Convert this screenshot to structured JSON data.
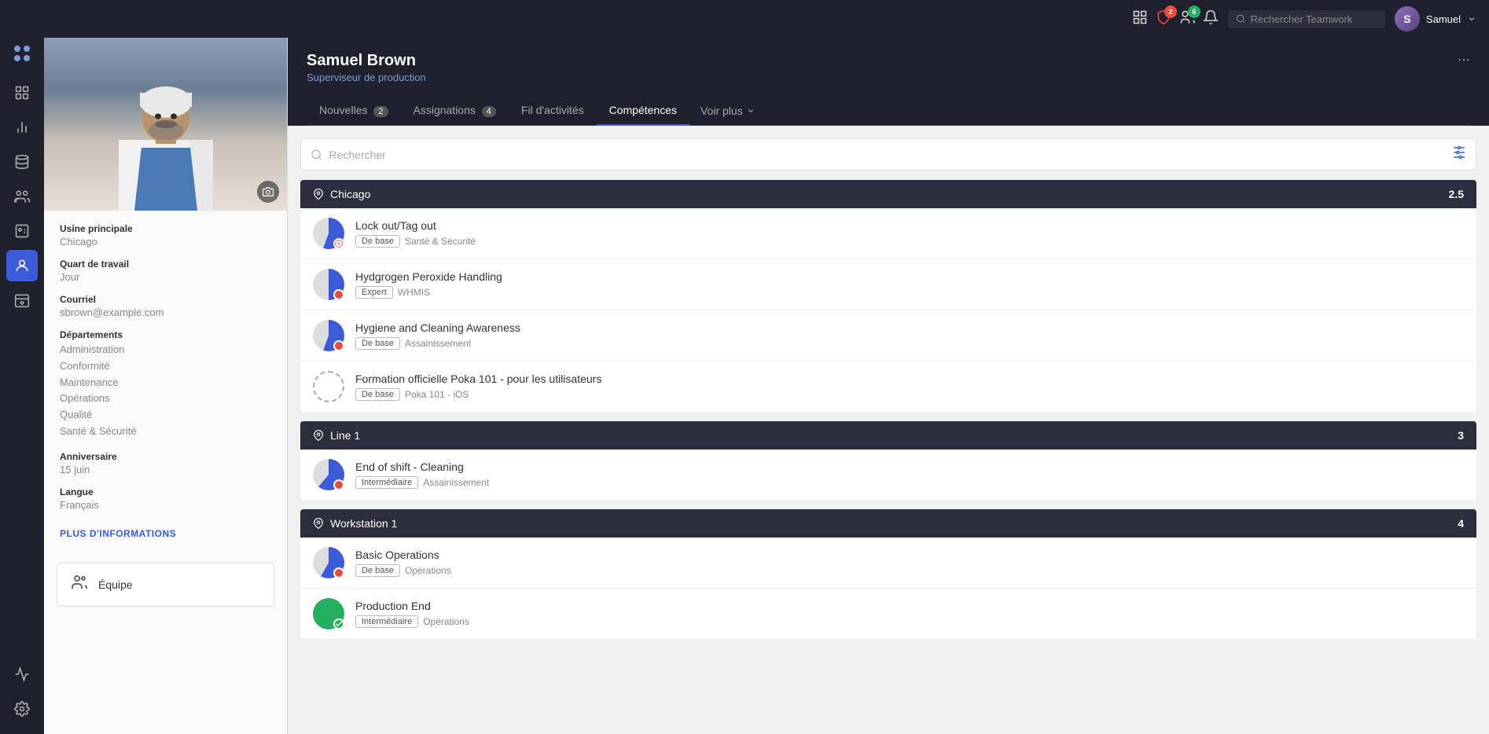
{
  "topbar": {
    "search_placeholder": "Rechercher Teamwork",
    "user_name": "Samuel",
    "badge_messages": "2",
    "badge_shield": "2",
    "badge_bell": "6"
  },
  "sidebar": {
    "items": [
      {
        "icon": "grid",
        "label": "Tableau de bord",
        "active": false
      },
      {
        "icon": "chart",
        "label": "Rapports",
        "active": false
      },
      {
        "icon": "layers",
        "label": "Modules",
        "active": false
      },
      {
        "icon": "users-group",
        "label": "Groupes",
        "active": false
      },
      {
        "icon": "team",
        "label": "Équipes",
        "active": false
      },
      {
        "icon": "person",
        "label": "Personnes",
        "active": true
      },
      {
        "icon": "hat",
        "label": "Formation",
        "active": false
      },
      {
        "icon": "bar-chart",
        "label": "Analytique",
        "active": false
      },
      {
        "icon": "settings",
        "label": "Paramètres",
        "active": false
      }
    ]
  },
  "profile": {
    "name": "Samuel Brown",
    "title": "Superviseur de production",
    "usine_label": "Usine principale",
    "usine_value": "Chicago",
    "quart_label": "Quart de travail",
    "quart_value": "Jour",
    "courriel_label": "Courriel",
    "courriel_value": "sbrown@example.com",
    "departements_label": "Départements",
    "departements": [
      "Administration",
      "Conformité",
      "Maintenance",
      "Opérations",
      "Qualité",
      "Santé & Sécurité"
    ],
    "anniversaire_label": "Anniversaire",
    "anniversaire_value": "15 juin",
    "langue_label": "Langue",
    "langue_value": "Français",
    "more_info": "PLUS D'INFORMATIONS",
    "team_label": "Équipe"
  },
  "tabs": [
    {
      "label": "Nouvelles",
      "badge": "2"
    },
    {
      "label": "Assignations",
      "badge": "4"
    },
    {
      "label": "Fil d'activités",
      "badge": ""
    },
    {
      "label": "Compétences",
      "badge": "",
      "active": true
    },
    {
      "label": "Voir plus",
      "badge": ""
    }
  ],
  "content": {
    "search_placeholder": "Rechercher",
    "sections": [
      {
        "location": "Chicago",
        "count": "2.5",
        "skills": [
          {
            "name": "Lock out/Tag out",
            "level": "De base",
            "category": "Santé & Sécurité",
            "status": "red",
            "pie": "partial"
          },
          {
            "name": "Hydgrogen Peroxide Handling",
            "level": "Expert",
            "category": "WHMIS",
            "status": "red",
            "pie": "half"
          },
          {
            "name": "Hygiene and Cleaning Awareness",
            "level": "De base",
            "category": "Assainissement",
            "status": "red",
            "pie": "partial"
          },
          {
            "name": "Formation officielle Poka 101 - pour les utilisateurs",
            "level": "De base",
            "category": "Poka 101 - iOS",
            "status": "none",
            "pie": "dashed"
          }
        ]
      },
      {
        "location": "Line 1",
        "count": "3",
        "skills": [
          {
            "name": "End of shift - Cleaning",
            "level": "Intermédiaire",
            "category": "Assainissement",
            "status": "red",
            "pie": "end-shift"
          }
        ]
      },
      {
        "location": "Workstation 1",
        "count": "4",
        "skills": [
          {
            "name": "Basic Operations",
            "level": "De base",
            "category": "Opérations",
            "status": "red",
            "pie": "basic-ops"
          },
          {
            "name": "Production End",
            "level": "Intermédiaire",
            "category": "Opérations",
            "status": "green",
            "pie": "full-green"
          }
        ]
      }
    ]
  }
}
